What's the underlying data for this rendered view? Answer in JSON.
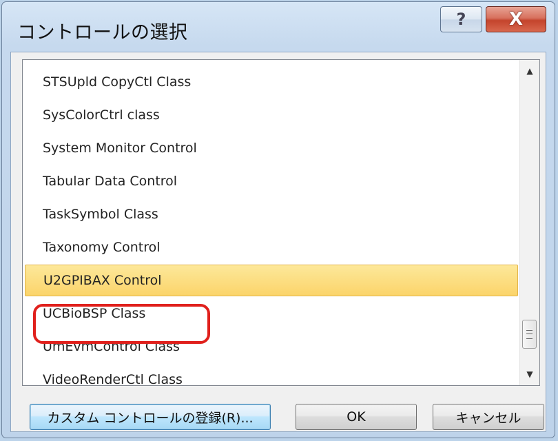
{
  "window": {
    "title": "コントロールの選択",
    "help_label": "?",
    "close_label": "X"
  },
  "list": {
    "items": [
      "STSUpld CopyCtl Class",
      "SysColorCtrl class",
      "System Monitor Control",
      "Tabular Data Control",
      "TaskSymbol Class",
      "Taxonomy Control",
      "U2GPIBAX Control",
      "UCBioBSP Class",
      "UmEvmControl Class",
      "VideoRenderCtl Class"
    ],
    "selected": "U2GPIBAX Control"
  },
  "buttons": {
    "custom_label": "カスタム コントロールの登録(R)...",
    "ok_label": "OK",
    "cancel_label": "キャンセル"
  },
  "colors": {
    "selection": "#fbd46a",
    "annotation_circle": "#e0201c",
    "close_button": "#c4442c"
  },
  "icons": {
    "scroll_up": "▲",
    "scroll_down": "▼"
  }
}
